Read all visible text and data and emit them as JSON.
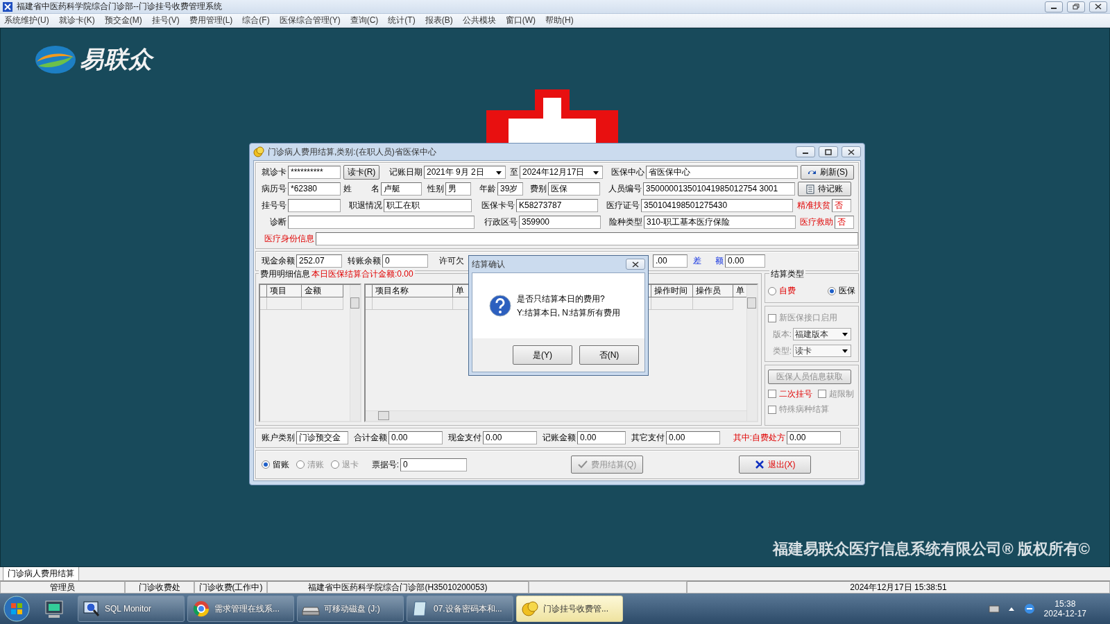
{
  "app_title": "福建省中医药科学院综合门诊部--门诊挂号收费管理系统",
  "menu": [
    "系统维护(U)",
    "就诊卡(K)",
    "预交金(M)",
    "挂号(V)",
    "费用管理(L)",
    "综合(F)",
    "医保综合管理(Y)",
    "查询(C)",
    "统计(T)",
    "报表(B)",
    "公共模块",
    "窗口(W)",
    "帮助(H)"
  ],
  "logo": "易联众",
  "copyright": "福建易联众医疗信息系统有限公司® 版权所有©",
  "window": {
    "title": "门诊病人费用结算,类别:(在职人员)省医保中心",
    "patient_rows": [
      [
        {
          "kind": "field",
          "label": "就诊卡",
          "value": "**********"
        },
        {
          "kind": "button",
          "label": "读卡(R)"
        },
        {
          "kind": "date",
          "label": "记账日期",
          "value": "2021年 9月 2日"
        },
        {
          "kind": "date",
          "label": "至",
          "value": "2024年12月17日"
        },
        {
          "kind": "field",
          "label": "医保中心",
          "value": "省医保中心"
        },
        {
          "kind": "refresh",
          "label": "刷新(S)"
        }
      ],
      [
        {
          "kind": "field",
          "label": "病历号",
          "value": "*62380"
        },
        {
          "kind": "field",
          "label": "姓 名",
          "value": "卢艇"
        },
        {
          "kind": "field",
          "label": "性别",
          "value": "男"
        },
        {
          "kind": "field",
          "label": "年龄",
          "value": "39岁"
        },
        {
          "kind": "field",
          "label": "费别",
          "value": "医保"
        },
        {
          "kind": "field",
          "label": "人员编号",
          "value": "350000013501041985012754 3001"
        },
        {
          "kind": "ledger",
          "label": "待记账"
        }
      ],
      [
        {
          "kind": "field",
          "label": "挂号号"
        },
        {
          "kind": "field",
          "label": "职退情况",
          "value": "职工在职"
        },
        {
          "kind": "field",
          "label": "医保卡号",
          "value": "K58273787"
        },
        {
          "kind": "field",
          "label": "医疗证号",
          "value": "350104198501275430"
        },
        {
          "kind": "flag",
          "label": "精准扶贫",
          "value": "否"
        }
      ],
      [
        {
          "kind": "field",
          "label": "诊断"
        },
        {
          "kind": "field",
          "label": "行政区号",
          "value": "359900"
        },
        {
          "kind": "field",
          "label": "险种类型",
          "value": "310-职工基本医疗保险"
        },
        {
          "kind": "flag",
          "label": "医疗救助",
          "value": "否"
        }
      ],
      [
        {
          "kind": "alert",
          "label": "医疗身份信息"
        }
      ]
    ],
    "balance": [
      {
        "kind": "field",
        "label": "现金余额",
        "value": "252.07"
      },
      {
        "kind": "field",
        "label": "转账余额",
        "value": "0"
      },
      {
        "kind": "label",
        "label": "许可欠"
      },
      {
        "kind": "field",
        "value": ".00"
      },
      {
        "kind": "diff",
        "label": "差 额",
        "value": "0.00"
      }
    ],
    "detail": {
      "title": "费用明细信息",
      "summary": "本日医保结算合计金额:0.00",
      "left_columns": [
        "项目",
        "金额"
      ],
      "columns": [
        "项目名称",
        "单",
        "操作时间",
        "操作员",
        "单"
      ]
    },
    "settle_type": {
      "title": "结算类型",
      "options": [
        {
          "label": "自费",
          "kind": "alert",
          "selected": false
        },
        {
          "label": "医保",
          "kind": "normal",
          "selected": true
        }
      ]
    },
    "insurance": {
      "new_interface": {
        "label": "新医保接口启用",
        "checked": false,
        "disabled": true
      },
      "selects": [
        {
          "label": "版本:",
          "value": "福建版本"
        },
        {
          "label": "类型:",
          "value": "读卡"
        }
      ],
      "fetch_button": {
        "label": "医保人员信息获取",
        "disabled": true
      },
      "checks": [
        {
          "label": "二次挂号",
          "kind": "alert",
          "checked": false,
          "disabled": false
        },
        {
          "label": "超限制",
          "kind": "normal",
          "checked": false,
          "disabled": true
        },
        {
          "label": "特殊病种结算",
          "kind": "normal",
          "checked": false,
          "disabled": true
        }
      ]
    },
    "totals": [
      {
        "kind": "field",
        "label": "账户类别",
        "value": "门诊预交金"
      },
      {
        "kind": "field",
        "label": "合计金额",
        "value": "0.00"
      },
      {
        "kind": "field",
        "label": "现金支付",
        "value": "0.00"
      },
      {
        "kind": "field",
        "label": "记账金额",
        "value": "0.00"
      },
      {
        "kind": "field",
        "label": "其它支付",
        "value": "0.00"
      },
      {
        "kind": "alert",
        "label": "其中:自费处方",
        "value": "0.00"
      }
    ],
    "account_options": [
      {
        "label": "留账",
        "selected": true,
        "disabled": false
      },
      {
        "label": "清账",
        "selected": false,
        "disabled": true
      },
      {
        "label": "退卡",
        "selected": false,
        "disabled": true
      }
    ],
    "receipt": {
      "label": "票据号:",
      "value": "0"
    },
    "settle_button": {
      "label": "费用结算(Q)",
      "disabled": true
    },
    "exit_button": {
      "label": "退出(X)"
    }
  },
  "confirm": {
    "title": "结算确认",
    "message": "是否只结算本日的费用?",
    "hint": "Y:结算本日, N:结算所有费用",
    "buttons": [
      "是(Y)",
      "否(N)"
    ]
  },
  "mdi_tabs": [
    {
      "label": "门诊病人费用结算",
      "selected": true
    }
  ],
  "status_bar": [
    "管理员",
    "门诊收费处",
    "门诊收费(工作中)",
    "福建省中医药科学院综合门诊部(H35010200053)",
    "2024年12月17日 15:38:51"
  ],
  "taskbar": {
    "items": [
      {
        "kind": "monitor",
        "label": "SQL Monitor",
        "selected": false
      },
      {
        "kind": "browser",
        "label": "需求管理在线系...",
        "selected": false
      },
      {
        "kind": "drive",
        "label": "可移动磁盘 (J:)",
        "selected": false
      },
      {
        "kind": "notebook",
        "label": "07.设备密码本和...",
        "selected": false
      },
      {
        "kind": "app",
        "label": "门诊挂号收费管...",
        "selected": true
      }
    ],
    "time": "15:38",
    "date": "2024-12-17"
  }
}
